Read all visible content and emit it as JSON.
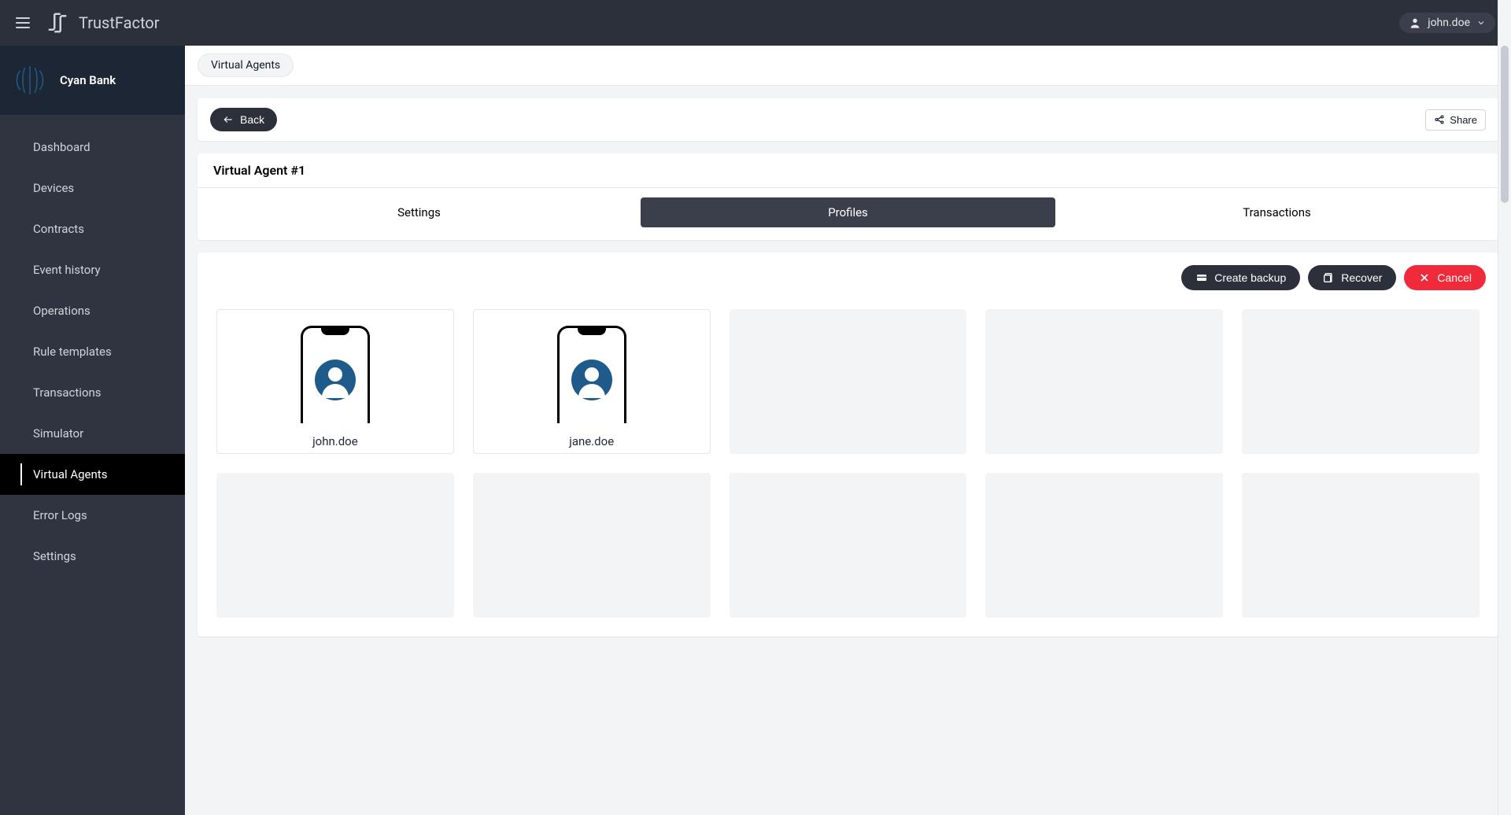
{
  "header": {
    "title": "TrustFactor",
    "user": "john.doe"
  },
  "org": {
    "name": "Cyan Bank"
  },
  "nav": [
    {
      "label": "Dashboard"
    },
    {
      "label": "Devices"
    },
    {
      "label": "Contracts"
    },
    {
      "label": "Event history"
    },
    {
      "label": "Operations"
    },
    {
      "label": "Rule templates"
    },
    {
      "label": "Transactions"
    },
    {
      "label": "Simulator"
    },
    {
      "label": "Virtual Agents",
      "active": true
    },
    {
      "label": "Error Logs"
    },
    {
      "label": "Settings"
    }
  ],
  "breadcrumb": {
    "label": "Virtual Agents"
  },
  "back": {
    "label": "Back"
  },
  "share": {
    "label": "Share"
  },
  "agent": {
    "title": "Virtual Agent #1"
  },
  "tabs": [
    {
      "label": "Settings"
    },
    {
      "label": "Profiles",
      "active": true
    },
    {
      "label": "Transactions"
    }
  ],
  "actions": {
    "create_backup": "Create backup",
    "recover": "Recover",
    "cancel": "Cancel"
  },
  "profiles": [
    {
      "name": "john.doe"
    },
    {
      "name": "jane.doe"
    }
  ],
  "slots_total": 10,
  "colors": {
    "dark": "#2b303b",
    "sidebar": "#2f3440",
    "org_bg": "#1d2634",
    "avatar": "#1e5b8a",
    "danger": "#ee2a3b"
  }
}
